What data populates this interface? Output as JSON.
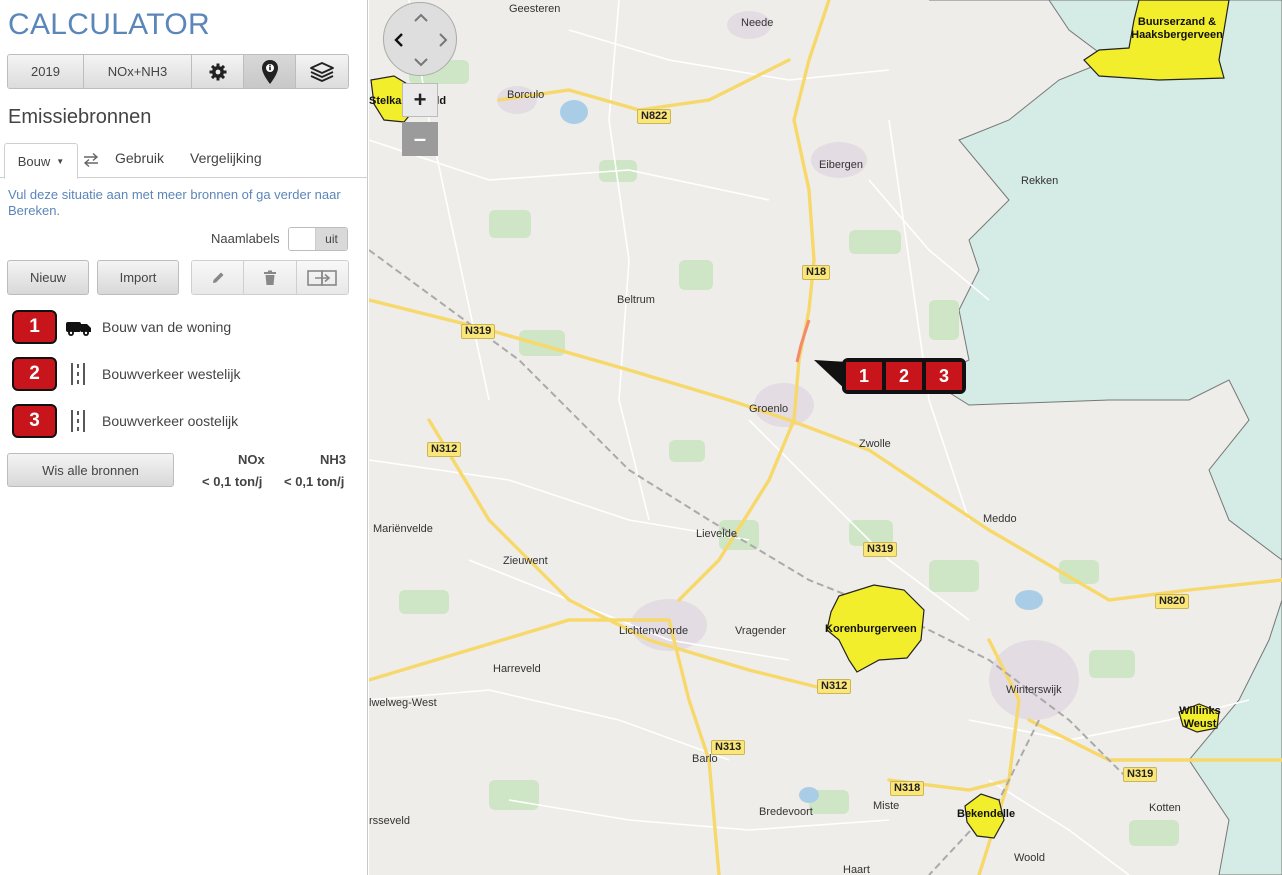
{
  "app": {
    "title": "CALCULATOR"
  },
  "toolbar": {
    "year": "2019",
    "substance": "NOx+NH3",
    "settings_icon": "gear-icon",
    "info_icon": "map-pin-info-icon",
    "layers_icon": "layers-icon"
  },
  "section": {
    "title": "Emissiebronnen"
  },
  "tabs": {
    "bouw": "Bouw",
    "gebruik": "Gebruik",
    "vergelijking": "Vergelijking"
  },
  "hint": "Vul deze situatie aan met meer bronnen of ga verder naar Bereken.",
  "naamlabels": {
    "label": "Naamlabels",
    "state": "uit"
  },
  "actions": {
    "new": "Nieuw",
    "import": "Import"
  },
  "sources": [
    {
      "id": "1",
      "label": "Bouw van de woning",
      "icon": "truck-icon"
    },
    {
      "id": "2",
      "label": "Bouwverkeer westelijk",
      "icon": "road-icon"
    },
    {
      "id": "3",
      "label": "Bouwverkeer oostelijk",
      "icon": "road-icon"
    }
  ],
  "clear_all": "Wis alle bronnen",
  "emissions": {
    "nox_label": "NOx",
    "nh3_label": "NH3",
    "nox_value": "< 0,1 ton/j",
    "nh3_value": "< 0,1 ton/j"
  },
  "map": {
    "places": [
      "Geesteren",
      "Neede",
      "Borculo",
      "Eibergen",
      "Rekken",
      "Beltrum",
      "Groenlo",
      "Zwolle",
      "Mariënvelde",
      "Zieuwent",
      "Lievelde",
      "Meddo",
      "Lichtenvoorde",
      "Vragender",
      "Harreveld",
      "lwelweg-West",
      "Winterswijk",
      "Barlo",
      "Bredevoort",
      "Miste",
      "Kotten",
      "Woold",
      "Haart",
      "rsseveld"
    ],
    "roads": [
      "N822",
      "N18",
      "N319",
      "N312",
      "N319",
      "N820",
      "N312",
      "N313",
      "N318",
      "N319"
    ],
    "natura": [
      "Buurserzand & Haaksbergerveen",
      "Stelkampsveld",
      "Korenburgerveen",
      "Willinks Weust",
      "Bekendelle"
    ],
    "zoom_in": "+",
    "zoom_out": "–",
    "cluster": [
      "1",
      "2",
      "3"
    ],
    "colors": {
      "natura": "#f2ee2c",
      "road_major": "#f7d86b",
      "source": "#c8141b",
      "water": "#d4ebe6"
    }
  }
}
